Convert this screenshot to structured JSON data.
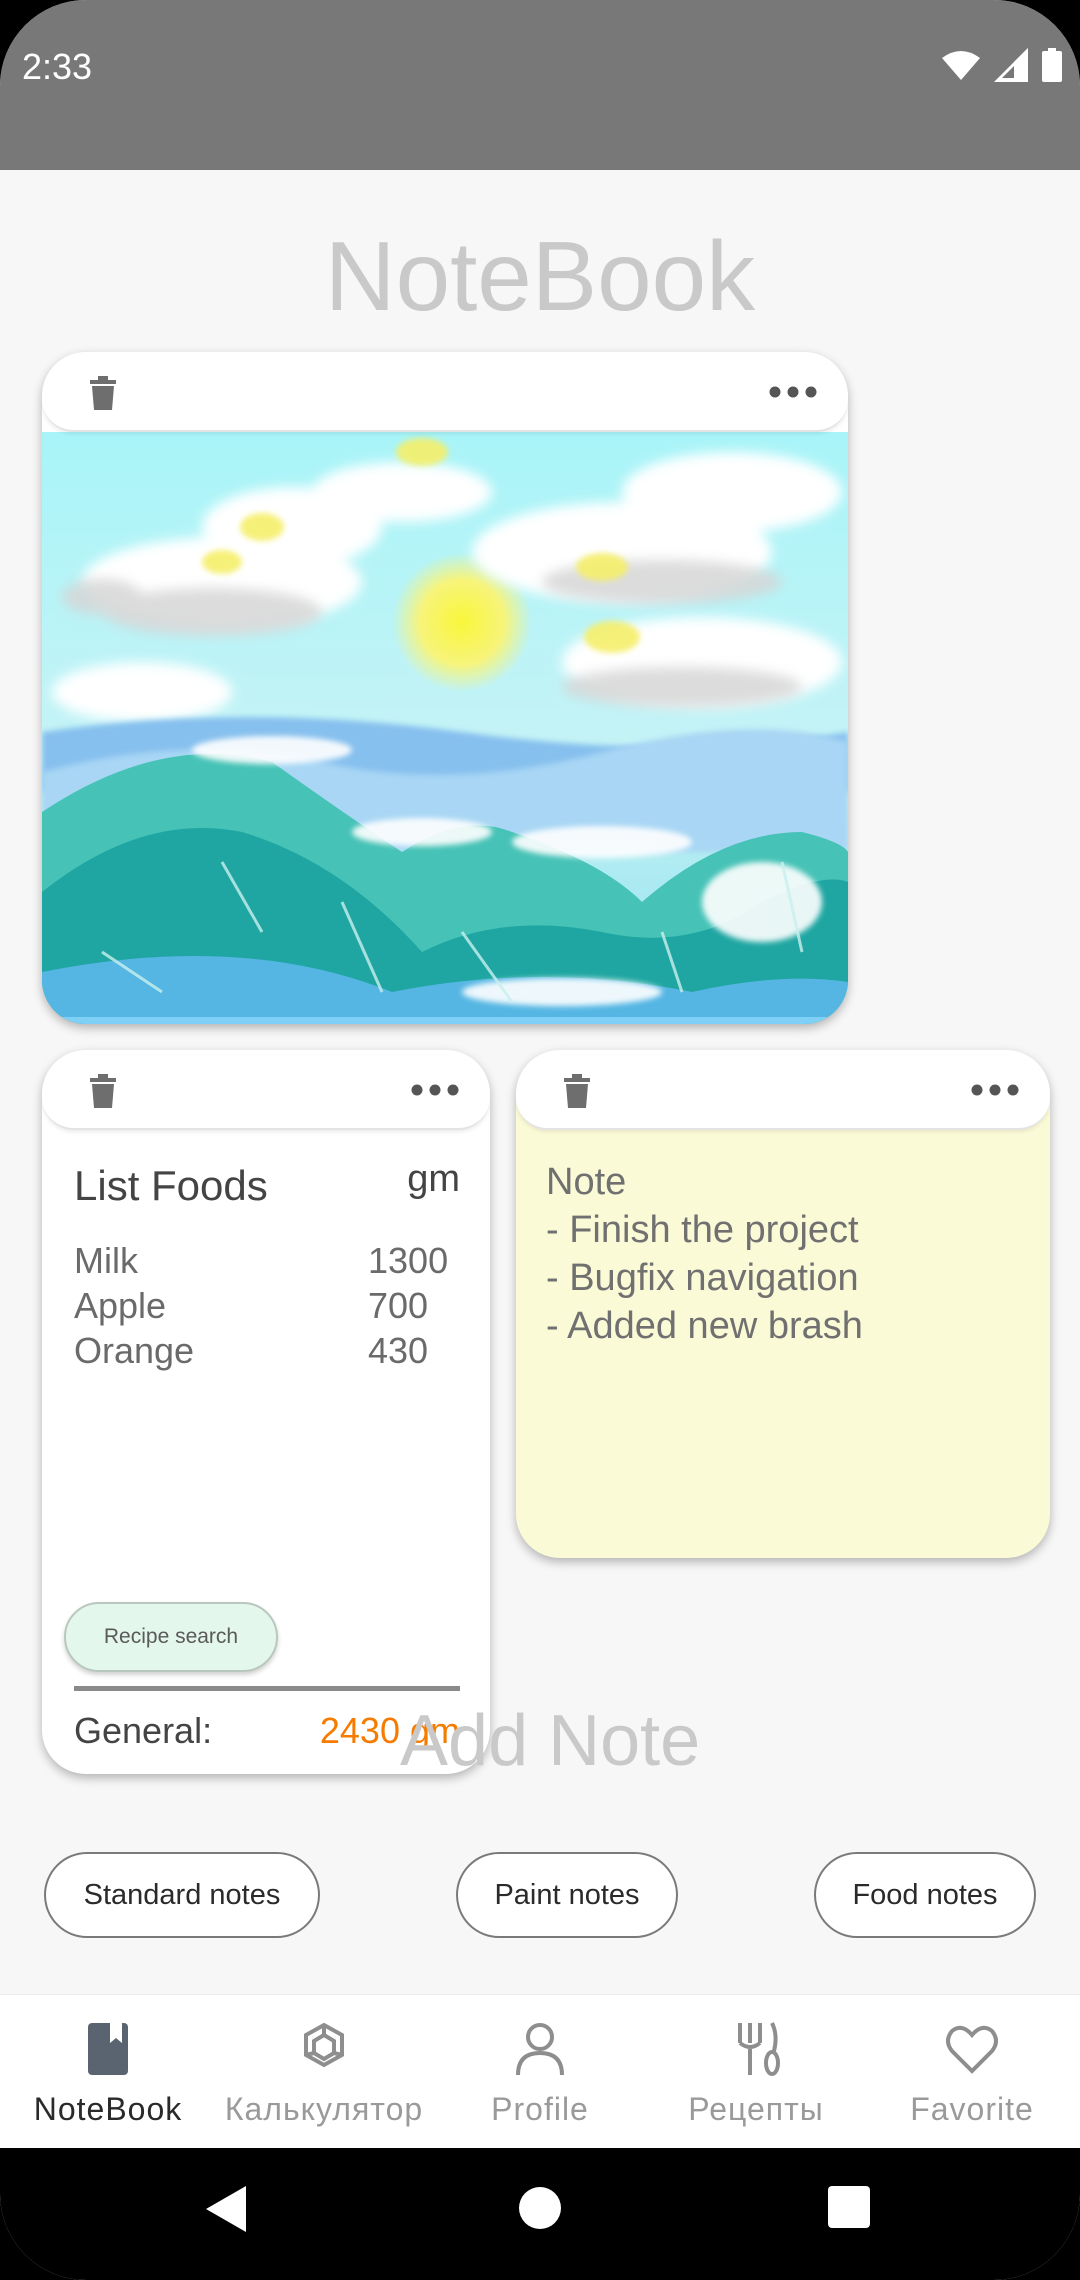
{
  "status_bar": {
    "time": "2:33"
  },
  "app_title": "NoteBook",
  "paint_card": {
    "delete_icon": "trash-icon",
    "menu_icon": "more-horizontal-icon"
  },
  "food_card": {
    "title": "List Foods",
    "unit": "gm",
    "items": [
      {
        "name": "Milk",
        "qty": "1300"
      },
      {
        "name": "Apple",
        "qty": "700"
      },
      {
        "name": "Orange",
        "qty": "430"
      }
    ],
    "recipe_button": "Recipe search",
    "general_label": "General:",
    "general_value": "2430 gm",
    "general_color": "#f57c00"
  },
  "note_card": {
    "text": "Note\n- Finish the project\n- Bugfix navigation\n- Added new brash",
    "background": "#fafad7"
  },
  "add_note_label": "Add Note",
  "chips": {
    "standard": "Standard notes",
    "paint": "Paint notes",
    "food": "Food notes"
  },
  "bottom_nav": {
    "items": [
      {
        "label": "NoteBook",
        "icon": "book-icon",
        "active": true
      },
      {
        "label": "Калькулятор",
        "icon": "hexagon-icon",
        "active": false
      },
      {
        "label": "Profile",
        "icon": "person-icon",
        "active": false
      },
      {
        "label": "Рецепты",
        "icon": "utensils-icon",
        "active": false
      },
      {
        "label": "Favorite",
        "icon": "heart-icon",
        "active": false
      }
    ]
  }
}
